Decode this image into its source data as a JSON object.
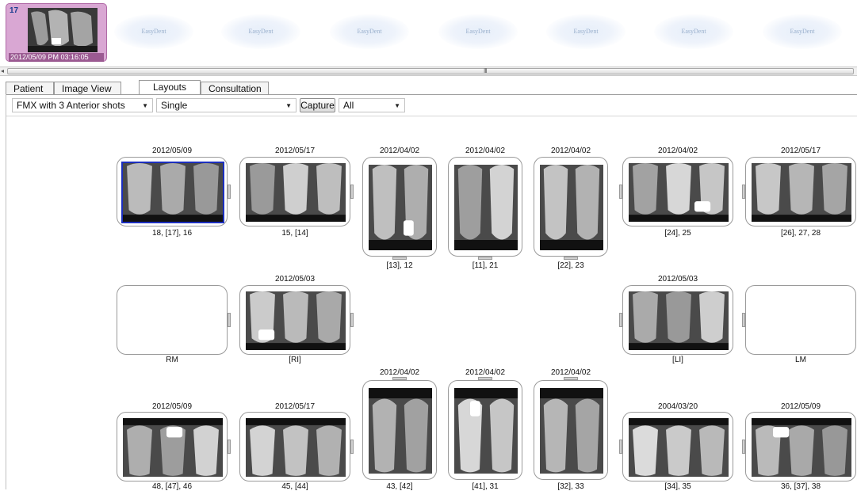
{
  "thumbnail_strip": {
    "selected": {
      "number": "17",
      "datetime": "2012/05/09 PM 03:16:05"
    },
    "placeholder_label": "EasyDent",
    "placeholder_count": 7
  },
  "scrollbar": {
    "left_arrow": "◂",
    "grip": "III"
  },
  "tabs": [
    {
      "label": "Patient"
    },
    {
      "label": "Image View"
    },
    {
      "label": "Layouts"
    },
    {
      "label": "Consultation"
    }
  ],
  "active_tab": "Layouts",
  "toolbar": {
    "layout_select": "FMX with 3 Anterior shots",
    "mode_select": "Single",
    "capture_label": "Capture",
    "filter_select": "All"
  },
  "slots": [
    {
      "id": "s1",
      "date": "2012/05/09",
      "caption": "18, [17], 16",
      "has_image": true,
      "selected": true
    },
    {
      "id": "s2",
      "date": "2012/05/17",
      "caption": "15, [14]",
      "has_image": true
    },
    {
      "id": "s3",
      "date": "2012/04/02",
      "caption": "[13], 12",
      "has_image": true
    },
    {
      "id": "s4",
      "date": "2012/04/02",
      "caption": "[11], 21",
      "has_image": true
    },
    {
      "id": "s5",
      "date": "2012/04/02",
      "caption": "[22], 23",
      "has_image": true
    },
    {
      "id": "s6",
      "date": "2012/04/02",
      "caption": "[24], 25",
      "has_image": true
    },
    {
      "id": "s7",
      "date": "2012/05/17",
      "caption": "[26], 27, 28",
      "has_image": true
    },
    {
      "id": "s8",
      "date": "",
      "caption": "RM",
      "has_image": false
    },
    {
      "id": "s9",
      "date": "2012/05/03",
      "caption": "[RI]",
      "has_image": true
    },
    {
      "id": "s10",
      "date": "2012/05/03",
      "caption": "[LI]",
      "has_image": true
    },
    {
      "id": "s11",
      "date": "",
      "caption": "LM",
      "has_image": false
    },
    {
      "id": "s12",
      "date": "2012/05/09",
      "caption": "48, [47], 46",
      "has_image": true
    },
    {
      "id": "s13",
      "date": "2012/05/17",
      "caption": "45, [44]",
      "has_image": true
    },
    {
      "id": "s14",
      "date": "2012/04/02",
      "caption": "43, [42]",
      "has_image": true
    },
    {
      "id": "s15",
      "date": "2012/04/02",
      "caption": "[41], 31",
      "has_image": true
    },
    {
      "id": "s16",
      "date": "2012/04/02",
      "caption": "[32], 33",
      "has_image": true
    },
    {
      "id": "s17",
      "date": "2004/03/20",
      "caption": "[34], 35",
      "has_image": true
    },
    {
      "id": "s18",
      "date": "2012/05/09",
      "caption": "36, [37], 38",
      "has_image": true
    }
  ]
}
